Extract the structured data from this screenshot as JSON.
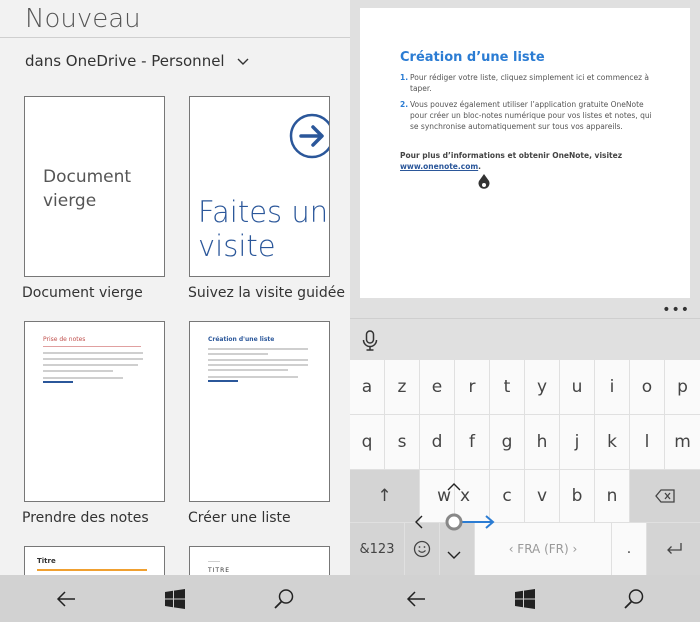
{
  "left_pane": {
    "title": "Nouveau",
    "location": "dans OneDrive - Personnel",
    "tiles": [
      {
        "label": "Document vierge",
        "preview_text": "Document vierge"
      },
      {
        "label": "Suivez la visite guidée",
        "preview_text": "Faites une visite"
      },
      {
        "label": "Prendre des notes",
        "preview_title": "Prise de notes"
      },
      {
        "label": "Créer une liste",
        "preview_title": "Création d'une liste"
      },
      {
        "label": "",
        "preview_title": "Titre"
      },
      {
        "label": "",
        "preview_title": "Titre"
      }
    ]
  },
  "right_pane": {
    "document": {
      "heading": "Création d’une liste",
      "items": [
        {
          "num": "1.",
          "text": "Pour rédiger votre liste, cliquez simplement ici et commencez à taper."
        },
        {
          "num": "2.",
          "text": "Vous pouvez également utiliser l’application gratuite OneNote pour créer un bloc-notes numérique pour vos listes et notes, qui se synchronise automatiquement sur tous vos appareils."
        }
      ],
      "footer_text": "Pour plus d’informations et obtenir OneNote, visitez",
      "footer_link": "www.onenote.com",
      "footer_end": "."
    },
    "more": "•••",
    "keyboard": {
      "row1": [
        "a",
        "z",
        "e",
        "r",
        "t",
        "y",
        "u",
        "i",
        "o",
        "p"
      ],
      "row2": [
        "q",
        "s",
        "d",
        "f",
        "g",
        "h",
        "j",
        "k",
        "l",
        "m"
      ],
      "row3": [
        "w",
        "x",
        "c",
        "v",
        "b",
        "n"
      ],
      "numbers_key": "&123",
      "space_label": "‹ FRA (FR) ›",
      "period": ".",
      "shift": "↑"
    }
  },
  "colors": {
    "accent": "#2b579a",
    "heading_blue": "#2b7cd3",
    "nav_bg": "#d2d2d2"
  }
}
